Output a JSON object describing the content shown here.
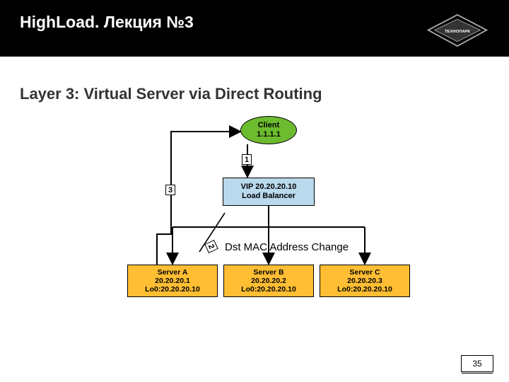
{
  "header": {
    "title": "HighLoad. Лекция №3",
    "logo_label": "ТЕХНОПАРК"
  },
  "section": {
    "title": "Layer 3: Virtual Server via Direct Routing"
  },
  "diagram": {
    "client": {
      "name": "Client",
      "ip": "1.1.1.1"
    },
    "vip": {
      "line1": "VIP 20.20.20.10",
      "line2": "Load Balancer"
    },
    "servers": {
      "a": {
        "name": "Server A",
        "ip": "20.20.20.1",
        "lo": "Lo0:20.20.20.10"
      },
      "b": {
        "name": "Server B",
        "ip": "20.20.20.2",
        "lo": "Lo0:20.20.20.10"
      },
      "c": {
        "name": "Server C",
        "ip": "20.20.20.3",
        "lo": "Lo0:20.20.20.10"
      }
    },
    "flows": {
      "step1": "1",
      "step2": "2",
      "step3": "3"
    },
    "annotation": "Dst MAC Address Change"
  },
  "page": {
    "number": "35"
  }
}
